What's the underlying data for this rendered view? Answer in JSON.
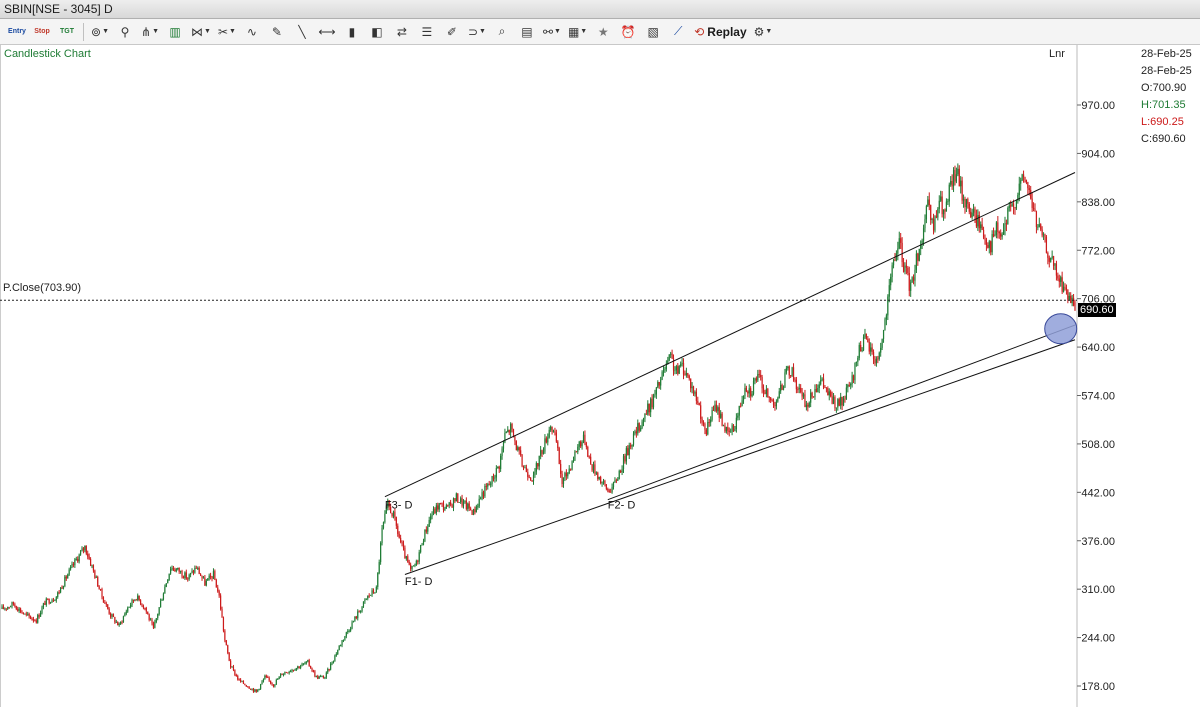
{
  "window": {
    "title": "SBIN[NSE - 3045] D"
  },
  "toolbar": {
    "items": [
      {
        "name": "entry-icon",
        "label": "Entry"
      },
      {
        "name": "stop-icon",
        "label": "Stop"
      },
      {
        "name": "target-icon",
        "label": "TGT"
      },
      {
        "name": "indicator-icon",
        "label": "⊚"
      },
      {
        "name": "pin-icon",
        "label": "⚲"
      },
      {
        "name": "pitchfork-icon",
        "label": "⋔"
      },
      {
        "name": "bar-chart-icon",
        "label": "▥"
      },
      {
        "name": "fib-icon",
        "label": "⋈"
      },
      {
        "name": "shapes-icon",
        "label": "✂"
      },
      {
        "name": "wave-icon",
        "label": "∿"
      },
      {
        "name": "pencil-icon",
        "label": "✎"
      },
      {
        "name": "trendline-icon",
        "label": "╲"
      },
      {
        "name": "horizontal-line-icon",
        "label": "⟷"
      },
      {
        "name": "volume-icon",
        "label": "▮"
      },
      {
        "name": "cube-icon",
        "label": "◧"
      },
      {
        "name": "arrows-icon",
        "label": "⇄"
      },
      {
        "name": "lines-icon",
        "label": "☰"
      },
      {
        "name": "ruler-icon",
        "label": "✐"
      },
      {
        "name": "magnet-icon",
        "label": "⊃"
      },
      {
        "name": "zoom-icon",
        "label": "⌕"
      },
      {
        "name": "file-icon",
        "label": "▤"
      },
      {
        "name": "link-icon",
        "label": "⚯"
      },
      {
        "name": "layout-icon",
        "label": "▦"
      },
      {
        "name": "star-icon",
        "label": "★"
      },
      {
        "name": "alert-icon",
        "label": "⏰"
      },
      {
        "name": "report-icon",
        "label": "▧"
      },
      {
        "name": "line-chart-icon",
        "label": "⟋"
      },
      {
        "name": "replay-icon",
        "label": "⟲"
      },
      {
        "name": "gear-icon",
        "label": "⚙"
      }
    ],
    "replay_label": "Replay"
  },
  "chart": {
    "title": "Candlestick Chart",
    "scale_label": "Lnr",
    "prev_close_label": "P.Close(703.90)",
    "last_price_label": "690.60",
    "ohlc": {
      "date1": "28-Feb-25",
      "date2": "28-Feb-25",
      "open": "O:700.90",
      "high": "H:701.35",
      "low": "L:690.25",
      "close": "C:690.60"
    },
    "annotations": [
      "F3- D",
      "F2- D",
      "F1- D"
    ]
  },
  "chart_data": {
    "type": "candlestick",
    "title": "Candlestick Chart",
    "y_axis": {
      "scale": "Lnr",
      "ylim": [
        160,
        1010
      ],
      "ticks": [
        970,
        904,
        838,
        772,
        706,
        640,
        574,
        508,
        442,
        376,
        310,
        244,
        178
      ]
    },
    "colors": {
      "up": "#1e7b34",
      "down": "#cc1a1a"
    },
    "prev_close": 703.9,
    "last": {
      "date": "28-Feb-25",
      "open": 700.9,
      "high": 701.35,
      "low": 690.25,
      "close": 690.6
    },
    "price_path": [
      {
        "i": 0,
        "c": 283
      },
      {
        "i": 8,
        "c": 290
      },
      {
        "i": 16,
        "c": 275
      },
      {
        "i": 24,
        "c": 268
      },
      {
        "i": 30,
        "c": 292
      },
      {
        "i": 38,
        "c": 300
      },
      {
        "i": 46,
        "c": 330
      },
      {
        "i": 52,
        "c": 350
      },
      {
        "i": 58,
        "c": 368
      },
      {
        "i": 64,
        "c": 335
      },
      {
        "i": 70,
        "c": 300
      },
      {
        "i": 76,
        "c": 275
      },
      {
        "i": 82,
        "c": 260
      },
      {
        "i": 88,
        "c": 285
      },
      {
        "i": 94,
        "c": 300
      },
      {
        "i": 100,
        "c": 285
      },
      {
        "i": 106,
        "c": 255
      },
      {
        "i": 112,
        "c": 300
      },
      {
        "i": 118,
        "c": 340
      },
      {
        "i": 124,
        "c": 335
      },
      {
        "i": 130,
        "c": 325
      },
      {
        "i": 136,
        "c": 340
      },
      {
        "i": 142,
        "c": 318
      },
      {
        "i": 148,
        "c": 330
      },
      {
        "i": 152,
        "c": 300
      },
      {
        "i": 156,
        "c": 240
      },
      {
        "i": 160,
        "c": 205
      },
      {
        "i": 166,
        "c": 185
      },
      {
        "i": 172,
        "c": 178
      },
      {
        "i": 178,
        "c": 170
      },
      {
        "i": 184,
        "c": 190
      },
      {
        "i": 190,
        "c": 180
      },
      {
        "i": 196,
        "c": 195
      },
      {
        "i": 202,
        "c": 200
      },
      {
        "i": 208,
        "c": 205
      },
      {
        "i": 214,
        "c": 210
      },
      {
        "i": 220,
        "c": 190
      },
      {
        "i": 226,
        "c": 190
      },
      {
        "i": 232,
        "c": 215
      },
      {
        "i": 238,
        "c": 240
      },
      {
        "i": 244,
        "c": 260
      },
      {
        "i": 250,
        "c": 280
      },
      {
        "i": 256,
        "c": 300
      },
      {
        "i": 262,
        "c": 310
      },
      {
        "i": 266,
        "c": 390
      },
      {
        "i": 270,
        "c": 425
      },
      {
        "i": 274,
        "c": 410
      },
      {
        "i": 278,
        "c": 380
      },
      {
        "i": 282,
        "c": 355
      },
      {
        "i": 286,
        "c": 335
      },
      {
        "i": 290,
        "c": 345
      },
      {
        "i": 294,
        "c": 375
      },
      {
        "i": 300,
        "c": 410
      },
      {
        "i": 306,
        "c": 425
      },
      {
        "i": 312,
        "c": 420
      },
      {
        "i": 318,
        "c": 435
      },
      {
        "i": 324,
        "c": 425
      },
      {
        "i": 330,
        "c": 415
      },
      {
        "i": 336,
        "c": 440
      },
      {
        "i": 342,
        "c": 455
      },
      {
        "i": 348,
        "c": 480
      },
      {
        "i": 352,
        "c": 520
      },
      {
        "i": 356,
        "c": 530
      },
      {
        "i": 360,
        "c": 505
      },
      {
        "i": 364,
        "c": 480
      },
      {
        "i": 368,
        "c": 470
      },
      {
        "i": 372,
        "c": 460
      },
      {
        "i": 376,
        "c": 490
      },
      {
        "i": 380,
        "c": 510
      },
      {
        "i": 384,
        "c": 535
      },
      {
        "i": 388,
        "c": 510
      },
      {
        "i": 392,
        "c": 455
      },
      {
        "i": 396,
        "c": 470
      },
      {
        "i": 400,
        "c": 490
      },
      {
        "i": 404,
        "c": 510
      },
      {
        "i": 408,
        "c": 515
      },
      {
        "i": 412,
        "c": 480
      },
      {
        "i": 416,
        "c": 470
      },
      {
        "i": 420,
        "c": 455
      },
      {
        "i": 424,
        "c": 445
      },
      {
        "i": 428,
        "c": 450
      },
      {
        "i": 432,
        "c": 470
      },
      {
        "i": 436,
        "c": 490
      },
      {
        "i": 440,
        "c": 510
      },
      {
        "i": 444,
        "c": 525
      },
      {
        "i": 448,
        "c": 540
      },
      {
        "i": 452,
        "c": 555
      },
      {
        "i": 456,
        "c": 570
      },
      {
        "i": 460,
        "c": 590
      },
      {
        "i": 464,
        "c": 610
      },
      {
        "i": 468,
        "c": 625
      },
      {
        "i": 472,
        "c": 605
      },
      {
        "i": 476,
        "c": 615
      },
      {
        "i": 480,
        "c": 600
      },
      {
        "i": 484,
        "c": 580
      },
      {
        "i": 488,
        "c": 560
      },
      {
        "i": 492,
        "c": 520
      },
      {
        "i": 496,
        "c": 545
      },
      {
        "i": 500,
        "c": 560
      },
      {
        "i": 504,
        "c": 540
      },
      {
        "i": 508,
        "c": 520
      },
      {
        "i": 512,
        "c": 530
      },
      {
        "i": 516,
        "c": 555
      },
      {
        "i": 520,
        "c": 590
      },
      {
        "i": 524,
        "c": 580
      },
      {
        "i": 528,
        "c": 600
      },
      {
        "i": 532,
        "c": 590
      },
      {
        "i": 536,
        "c": 570
      },
      {
        "i": 540,
        "c": 565
      },
      {
        "i": 544,
        "c": 575
      },
      {
        "i": 548,
        "c": 600
      },
      {
        "i": 552,
        "c": 610
      },
      {
        "i": 556,
        "c": 590
      },
      {
        "i": 560,
        "c": 570
      },
      {
        "i": 564,
        "c": 560
      },
      {
        "i": 568,
        "c": 580
      },
      {
        "i": 572,
        "c": 595
      },
      {
        "i": 576,
        "c": 585
      },
      {
        "i": 580,
        "c": 570
      },
      {
        "i": 584,
        "c": 560
      },
      {
        "i": 588,
        "c": 565
      },
      {
        "i": 592,
        "c": 580
      },
      {
        "i": 596,
        "c": 600
      },
      {
        "i": 600,
        "c": 640
      },
      {
        "i": 604,
        "c": 650
      },
      {
        "i": 608,
        "c": 635
      },
      {
        "i": 612,
        "c": 620
      },
      {
        "i": 616,
        "c": 650
      },
      {
        "i": 620,
        "c": 700
      },
      {
        "i": 624,
        "c": 760
      },
      {
        "i": 628,
        "c": 780
      },
      {
        "i": 632,
        "c": 745
      },
      {
        "i": 636,
        "c": 720
      },
      {
        "i": 640,
        "c": 760
      },
      {
        "i": 644,
        "c": 790
      },
      {
        "i": 648,
        "c": 830
      },
      {
        "i": 652,
        "c": 800
      },
      {
        "i": 656,
        "c": 840
      },
      {
        "i": 660,
        "c": 820
      },
      {
        "i": 664,
        "c": 860
      },
      {
        "i": 668,
        "c": 880
      },
      {
        "i": 672,
        "c": 850
      },
      {
        "i": 676,
        "c": 830
      },
      {
        "i": 680,
        "c": 820
      },
      {
        "i": 684,
        "c": 810
      },
      {
        "i": 688,
        "c": 790
      },
      {
        "i": 692,
        "c": 780
      },
      {
        "i": 696,
        "c": 800
      },
      {
        "i": 700,
        "c": 790
      },
      {
        "i": 704,
        "c": 820
      },
      {
        "i": 708,
        "c": 835
      },
      {
        "i": 712,
        "c": 860
      },
      {
        "i": 716,
        "c": 870
      },
      {
        "i": 720,
        "c": 845
      },
      {
        "i": 724,
        "c": 810
      },
      {
        "i": 728,
        "c": 790
      },
      {
        "i": 732,
        "c": 770
      },
      {
        "i": 736,
        "c": 750
      },
      {
        "i": 740,
        "c": 730
      },
      {
        "i": 744,
        "c": 720
      },
      {
        "i": 748,
        "c": 700
      },
      {
        "i": 751,
        "c": 690.6
      }
    ],
    "trendlines": [
      {
        "name": "channel-upper-line",
        "p1": {
          "i": 268,
          "price": 436
        },
        "p2": {
          "i": 751,
          "price": 878
        }
      },
      {
        "name": "channel-lower-line",
        "p1": {
          "i": 282,
          "price": 330
        },
        "p2": {
          "i": 751,
          "price": 650
        }
      },
      {
        "name": "support-line",
        "p1": {
          "i": 424,
          "price": 432
        },
        "p2": {
          "i": 751,
          "price": 670
        }
      }
    ],
    "annotations": [
      {
        "text": "F3- D",
        "i": 268,
        "price": 420
      },
      {
        "text": "F2- D",
        "i": 424,
        "price": 420
      },
      {
        "text": "F1- D",
        "i": 282,
        "price": 316
      }
    ],
    "target_zone": {
      "i": 741,
      "price": 665
    }
  }
}
